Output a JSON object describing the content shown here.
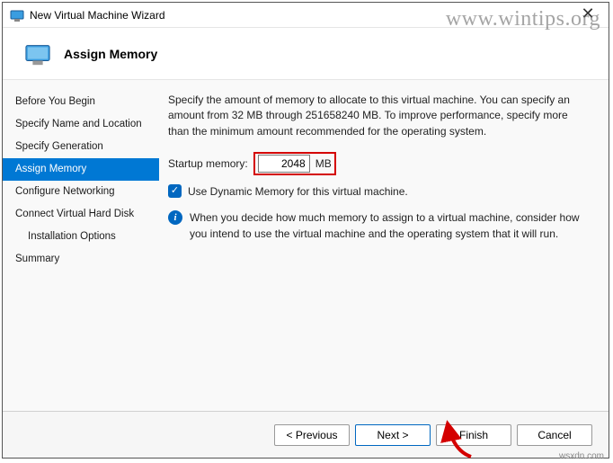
{
  "window": {
    "title": "New Virtual Machine Wizard"
  },
  "header": {
    "title": "Assign Memory"
  },
  "sidebar": {
    "items": [
      {
        "label": "Before You Begin"
      },
      {
        "label": "Specify Name and Location"
      },
      {
        "label": "Specify Generation"
      },
      {
        "label": "Assign Memory"
      },
      {
        "label": "Configure Networking"
      },
      {
        "label": "Connect Virtual Hard Disk"
      },
      {
        "label": "Installation Options"
      },
      {
        "label": "Summary"
      }
    ],
    "active_index": 3
  },
  "content": {
    "intro": "Specify the amount of memory to allocate to this virtual machine. You can specify an amount from 32 MB through 251658240 MB. To improve performance, specify more than the minimum amount recommended for the operating system.",
    "startup_label": "Startup memory:",
    "startup_value": "2048",
    "unit": "MB",
    "dynamic_checkbox_label": "Use Dynamic Memory for this virtual machine.",
    "dynamic_checked": true,
    "info_text": "When you decide how much memory to assign to a virtual machine, consider how you intend to use the virtual machine and the operating system that it will run."
  },
  "footer": {
    "previous": "< Previous",
    "next": "Next >",
    "finish": "Finish",
    "cancel": "Cancel"
  },
  "watermark": "www.wintips.org",
  "attribution": "wsxdn.com",
  "colors": {
    "accent": "#0067c0",
    "highlight": "#d40000"
  }
}
